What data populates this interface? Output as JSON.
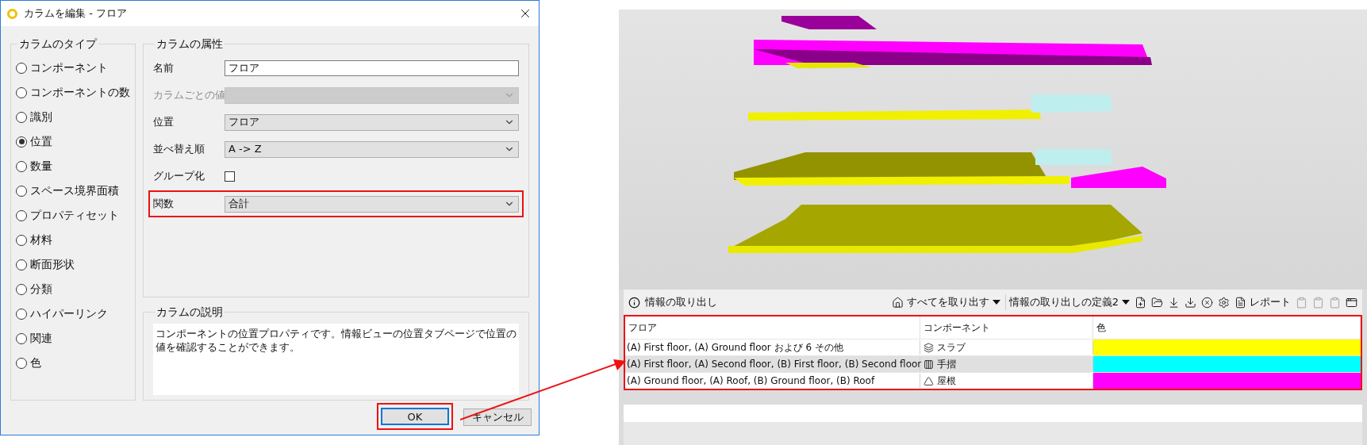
{
  "dialog": {
    "title": "カラムを編集 - フロア",
    "type_group": {
      "title": "カラムのタイプ",
      "options": [
        {
          "label": "コンポーネント",
          "selected": false
        },
        {
          "label": "コンポーネントの数",
          "selected": false
        },
        {
          "label": "識別",
          "selected": false
        },
        {
          "label": "位置",
          "selected": true
        },
        {
          "label": "数量",
          "selected": false
        },
        {
          "label": "スペース境界面積",
          "selected": false
        },
        {
          "label": "プロパティセット",
          "selected": false
        },
        {
          "label": "材料",
          "selected": false
        },
        {
          "label": "断面形状",
          "selected": false
        },
        {
          "label": "分類",
          "selected": false
        },
        {
          "label": "ハイパーリンク",
          "selected": false
        },
        {
          "label": "関連",
          "selected": false
        },
        {
          "label": "色",
          "selected": false
        }
      ]
    },
    "attributes": {
      "title": "カラムの属性",
      "fields": [
        {
          "kind": "text",
          "label": "名前",
          "value": "フロア"
        },
        {
          "kind": "select",
          "label": "カラムごとの値",
          "disabled": true,
          "highlighted": false
        },
        {
          "kind": "select",
          "label": "位置",
          "value": "フロア",
          "disabled": false,
          "highlighted": false
        },
        {
          "kind": "select",
          "label": "並べ替え順",
          "value": "A -> Z",
          "disabled": false,
          "highlighted": false
        },
        {
          "kind": "checkbox",
          "label": "グループ化",
          "checked": false
        },
        {
          "kind": "select",
          "label": "関数",
          "value": "合計",
          "disabled": false,
          "highlighted": true
        }
      ]
    },
    "description": {
      "title": "カラムの説明",
      "text": "コンポーネントの位置プロパティです。情報ビューの位置タブページで位置の値を確認することができます。"
    },
    "buttons": [
      {
        "label": "OK",
        "default": true,
        "highlighted": true
      },
      {
        "label": "キャンセル",
        "default": false,
        "highlighted": false
      }
    ]
  },
  "extraction": {
    "title": "情報の取り出し",
    "extract_all": "すべてを取り出す",
    "definition": "情報の取り出しの定義2",
    "report": "レポート",
    "table": {
      "highlighted": true,
      "columns": [
        "フロア",
        "コンポーネント",
        "色"
      ],
      "rows": [
        {
          "floor": "(A) First floor, (A) Ground floor および 6 その他",
          "component": "スラブ",
          "kind": "slab",
          "color": "#ffff00"
        },
        {
          "floor": "(A) First floor, (A) Second floor, (B) First floor, (B) Second floor",
          "component": "手摺",
          "kind": "railing",
          "color": "#00ffff"
        },
        {
          "floor": "(A) Ground floor, (A) Roof, (B) Ground floor, (B) Roof",
          "component": "屋根",
          "kind": "roof",
          "color": "#ff00ff"
        }
      ]
    }
  }
}
